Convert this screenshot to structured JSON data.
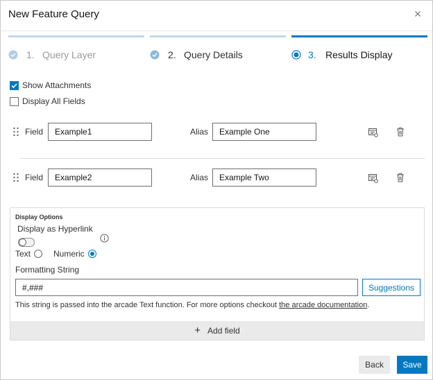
{
  "dialog": {
    "title": "New Feature Query",
    "close_icon": "close-icon"
  },
  "steps": [
    {
      "number": "1.",
      "label": "Query Layer",
      "state": "completed",
      "icon": "check-circle-icon"
    },
    {
      "number": "2.",
      "label": "Query Details",
      "state": "completed",
      "icon": "check-circle-icon"
    },
    {
      "number": "3.",
      "label": "Results Display",
      "state": "active",
      "icon": "radio-active-icon"
    }
  ],
  "options": {
    "show_attachments": {
      "label": "Show Attachments",
      "checked": true
    },
    "display_all_fields": {
      "label": "Display All Fields",
      "checked": false
    }
  },
  "fields": [
    {
      "field_label": "Field",
      "field_value": "Example1",
      "alias_label": "Alias",
      "alias_value": "Example One"
    },
    {
      "field_label": "Field",
      "field_value": "Example2",
      "alias_label": "Alias",
      "alias_value": "Example Two"
    }
  ],
  "display_options": {
    "heading": "Display Options",
    "hyperlink_label": "Display as Hyperlink",
    "hyperlink_on": false,
    "info_icon": "info-icon",
    "type_text_label": "Text",
    "type_numeric_label": "Numeric",
    "selected_type": "Numeric",
    "formatting_label": "Formatting String",
    "formatting_value": "#,###",
    "suggestions_label": "Suggestions",
    "help_prefix": "This string is passed into the arcade Text function. For more options checkout ",
    "help_link": "the arcade documentation",
    "help_suffix": "."
  },
  "add_field_label": "Add field",
  "footer": {
    "back_label": "Back",
    "save_label": "Save"
  },
  "colors": {
    "accent": "#0079c1",
    "step_completed_bar": "#bfd8ec",
    "step_completed_icon": "#8ab9dc"
  }
}
